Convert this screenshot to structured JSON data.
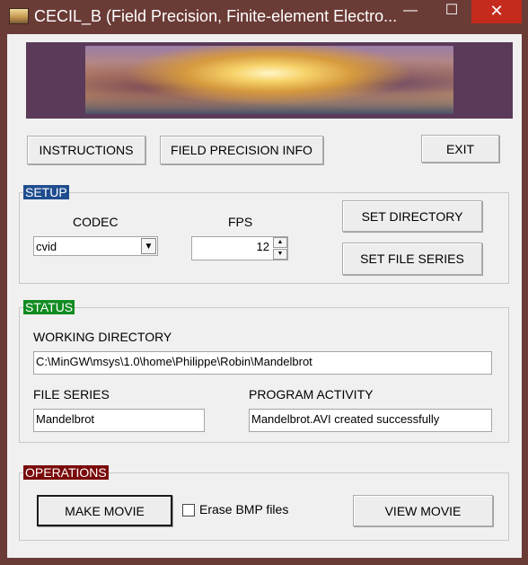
{
  "window": {
    "title": "CECIL_B (Field Precision, Finite-element Electro...",
    "minimize_glyph": "—",
    "maximize_glyph": "☐",
    "close_glyph": "✕",
    "title_bar_color": "#6b3b36"
  },
  "top_buttons": {
    "instructions": "INSTRUCTIONS",
    "field_precision_info": "FIELD PRECISION INFO",
    "exit": "EXIT"
  },
  "setup": {
    "title": "SETUP",
    "title_color": "#1f4d8f",
    "codec_label": "CODEC",
    "codec_value": "cvid",
    "fps_label": "FPS",
    "fps_value": "12",
    "set_directory": "SET DIRECTORY",
    "set_file_series": "SET FILE SERIES"
  },
  "status": {
    "title": "STATUS",
    "title_color": "#118c21",
    "working_directory_label": "WORKING DIRECTORY",
    "working_directory_value": "C:\\MinGW\\msys\\1.0\\home\\Philippe\\Robin\\Mandelbrot",
    "file_series_label": "FILE SERIES",
    "file_series_value": "Mandelbrot",
    "program_activity_label": "PROGRAM ACTIVITY",
    "program_activity_value": "Mandelbrot.AVI created successfully"
  },
  "operations": {
    "title": "OPERATIONS",
    "title_color": "#7a0a0a",
    "make_movie": "MAKE MOVIE",
    "erase_bmp_label": "Erase BMP files",
    "erase_bmp_checked": false,
    "view_movie": "VIEW MOVIE"
  },
  "icons": {
    "app": "app-icon",
    "codec_dropdown": "chevron-down-icon",
    "fps_up": "spin-up-icon",
    "fps_down": "spin-down-icon"
  }
}
